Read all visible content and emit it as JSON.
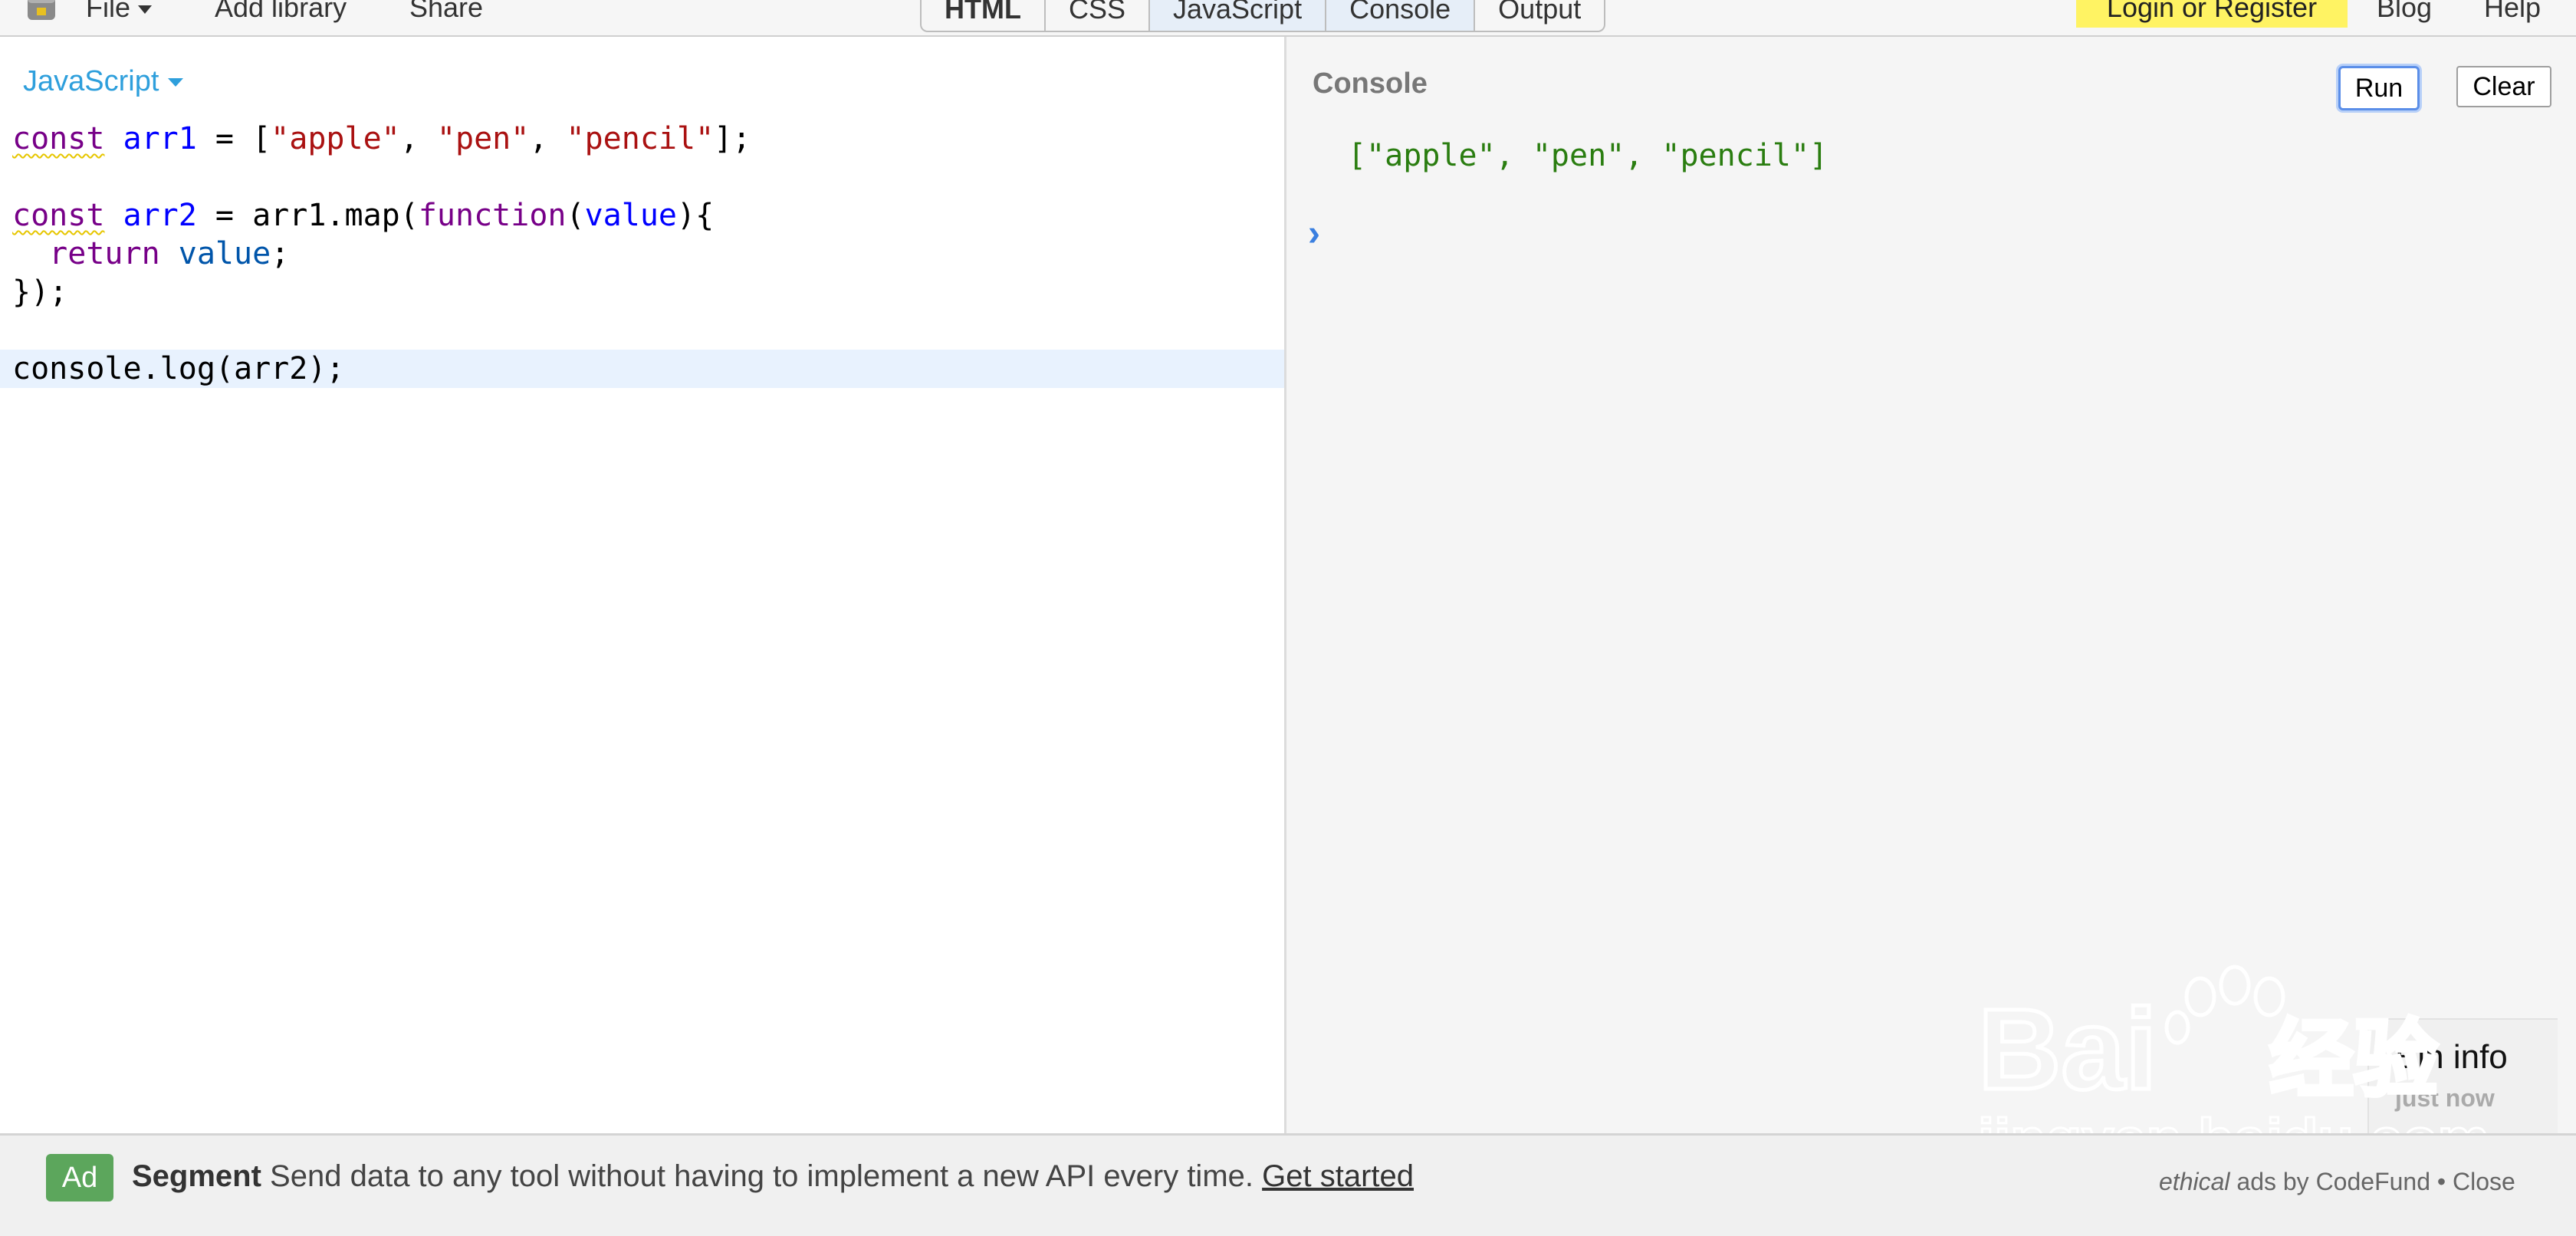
{
  "toolbar": {
    "file_label": "File",
    "add_library_label": "Add library",
    "share_label": "Share",
    "panel_tabs": [
      {
        "label": "HTML"
      },
      {
        "label": "CSS"
      },
      {
        "label": "JavaScript"
      },
      {
        "label": "Console"
      },
      {
        "label": "Output"
      }
    ],
    "login_label": "Login or Register",
    "blog_label": "Blog",
    "help_label": "Help"
  },
  "editor": {
    "language": "JavaScript",
    "lines": [
      [
        {
          "t": "const",
          "c": "kw squig"
        },
        {
          "t": " "
        },
        {
          "t": "arr1",
          "c": "def"
        },
        {
          "t": " = ["
        },
        {
          "t": "\"apple\"",
          "c": "str"
        },
        {
          "t": ", "
        },
        {
          "t": "\"pen\"",
          "c": "str"
        },
        {
          "t": ", "
        },
        {
          "t": "\"pencil\"",
          "c": "str"
        },
        {
          "t": "];"
        }
      ],
      [],
      [
        {
          "t": "const",
          "c": "kw squig"
        },
        {
          "t": " "
        },
        {
          "t": "arr2",
          "c": "def"
        },
        {
          "t": " = arr1.map("
        },
        {
          "t": "function",
          "c": "kw"
        },
        {
          "t": "("
        },
        {
          "t": "value",
          "c": "def"
        },
        {
          "t": "){"
        }
      ],
      [
        {
          "t": "  "
        },
        {
          "t": "return",
          "c": "kw"
        },
        {
          "t": " "
        },
        {
          "t": "value",
          "c": "var2"
        },
        {
          "t": ";"
        }
      ],
      [
        {
          "t": "});"
        }
      ],
      [],
      [
        {
          "t": "console.log(arr2);"
        }
      ]
    ],
    "active_line_index": 6
  },
  "console": {
    "title": "Console",
    "run_label": "Run",
    "clear_label": "Clear",
    "output": "[\"apple\", \"pen\", \"pencil\"]",
    "prompt_symbol": "›",
    "bin_info_title": "Bin info",
    "bin_info_time": "just now"
  },
  "watermark": {
    "brand": "Bai",
    "brand_cn": "经验",
    "site": "jingyan.baidu.com"
  },
  "ad": {
    "badge": "Ad",
    "brand": "Segment",
    "text": " Send data to any tool without having to implement a new API every time. ",
    "link": "Get started",
    "credit_ethical": "ethical",
    "credit_rest": " ads by CodeFund • ",
    "close_label": "Close"
  },
  "colors": {
    "accent": "#2e9fdc",
    "login_bg": "#fff363",
    "string": "#aa1111",
    "keyword": "#770088",
    "console_output": "#2a7d10",
    "ad_badge": "#5ca65c"
  }
}
